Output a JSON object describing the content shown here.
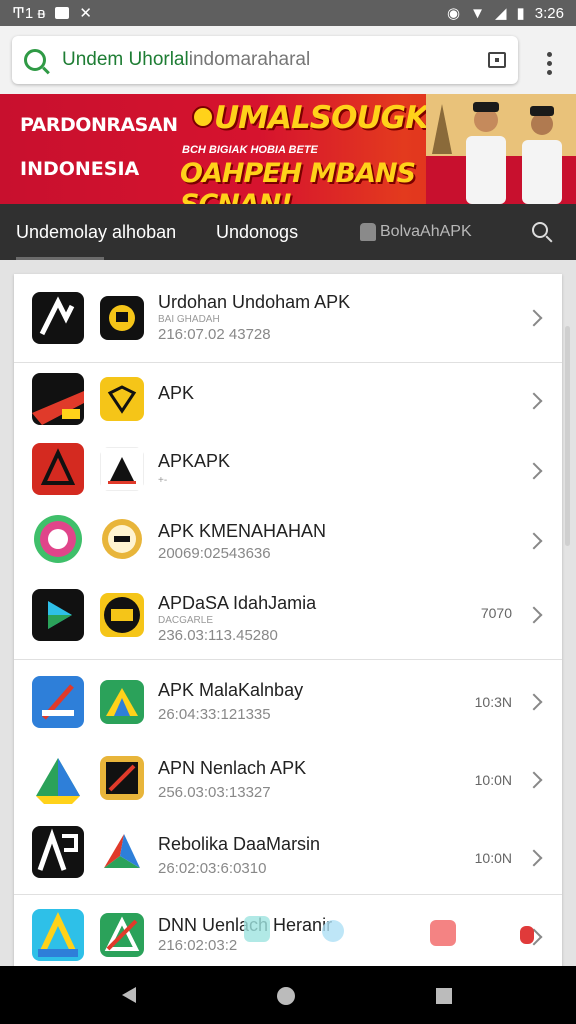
{
  "status_bar": {
    "left": "Ͳ1 ᴃ",
    "time": "3:26"
  },
  "url_bar": {
    "host": "Undem Uhorlal",
    "path": "indomaraharal"
  },
  "banner": {
    "left_line1": "PARDONRASAN",
    "left_line2": "INDONESIA",
    "title": "UMALSOUGK !",
    "subtitle": "BCH BIGIAK  HOBIA BETE",
    "tagline": "OAHPEH MBANS SCNAN!"
  },
  "nav": {
    "tabs": [
      "Undemolay alhoban",
      "Undonogs",
      "BolvaAhAPK"
    ]
  },
  "apps": [
    {
      "title": "Urdohan Undoham APK",
      "note": "BAI GHADAH",
      "sub": "216:07.02 43728",
      "size": ""
    },
    {
      "title": "APK",
      "note": "",
      "sub": "",
      "size": ""
    },
    {
      "title": "APKAPK",
      "note": "+-",
      "sub": "",
      "size": ""
    },
    {
      "title": "APK KMENAHAHAN",
      "note": "",
      "sub": "20069:02543636",
      "size": ""
    },
    {
      "title": "APDaSA IdahJamia",
      "note": "DACGARLE",
      "sub": "236.03:113.45280",
      "size": "7070"
    },
    {
      "title": "APK MalaKalnbay",
      "note": "",
      "sub": "26:04:33:121335",
      "size": "10:3N"
    },
    {
      "title": "APN Nenlach APK",
      "note": "",
      "sub": "256.03:03:13327",
      "size": "10:0N"
    },
    {
      "title": "Rebolika DaaMarsin",
      "note": "",
      "sub": "26:02:03:6:0310",
      "size": "10:0N"
    },
    {
      "title": "DNN Uenlach Heranir",
      "note": "",
      "sub": "216:02:03:2",
      "size": ""
    }
  ],
  "colors": {
    "accent_green": "#2f9a45",
    "banner_red": "#c8102e",
    "banner_yellow": "#ffd21a",
    "nav_dark": "#303030"
  }
}
